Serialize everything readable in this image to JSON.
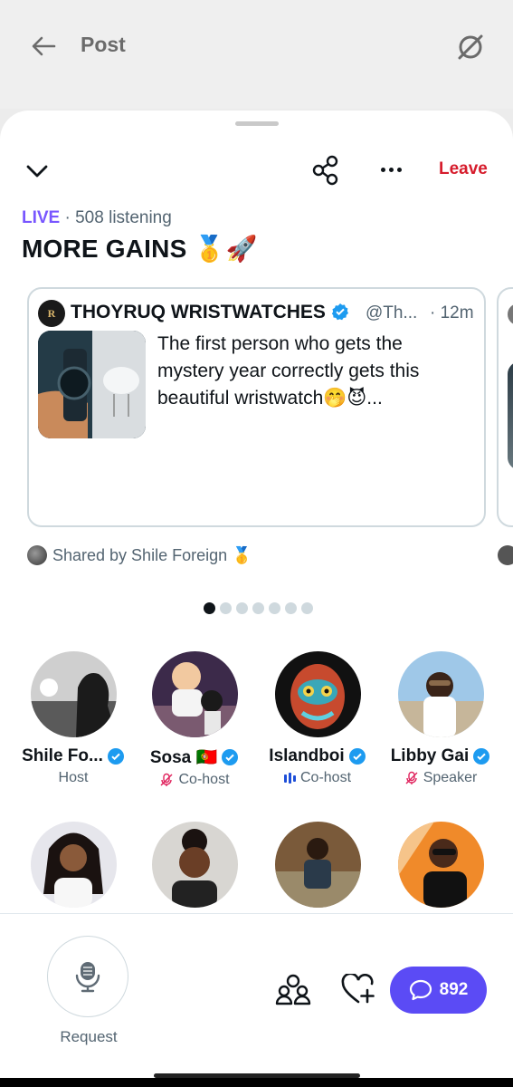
{
  "header": {
    "title": "Post"
  },
  "space": {
    "live_label": "LIVE",
    "listening": " · 508 listening",
    "title": "MORE GAINS 🥇🚀",
    "leave_label": "Leave"
  },
  "card": {
    "author_name": "THOYRUQ WRISTWATCHES",
    "handle": "@Th...",
    "time": "· 12m",
    "text": "The first person who gets the mystery year correctly gets this beautiful wristwatch🤭😈...",
    "shared_by": "Shared by Shile Foreign 🥇"
  },
  "carousel": {
    "pages": 7,
    "active": 0
  },
  "participants": [
    {
      "name": "Shile Fo...",
      "role": "Host",
      "role_icon": "none",
      "verified": true
    },
    {
      "name": "Sosa 🇵🇹",
      "role": "Co-host",
      "role_icon": "mic-off-icon",
      "verified": true
    },
    {
      "name": "Islandboi",
      "role": "Co-host",
      "role_icon": "speaking-bars-icon",
      "verified": true
    },
    {
      "name": "Libby Gai",
      "role": "Speaker",
      "role_icon": "mic-off-icon",
      "verified": true
    }
  ],
  "bottom": {
    "request_label": "Request",
    "chat_count": "892"
  },
  "colors": {
    "live": "#7856ff",
    "leave": "#d61c2c",
    "verified": "#1d9bf0",
    "chat_button": "#5b4bf5",
    "mic_off": "#e0245e"
  }
}
